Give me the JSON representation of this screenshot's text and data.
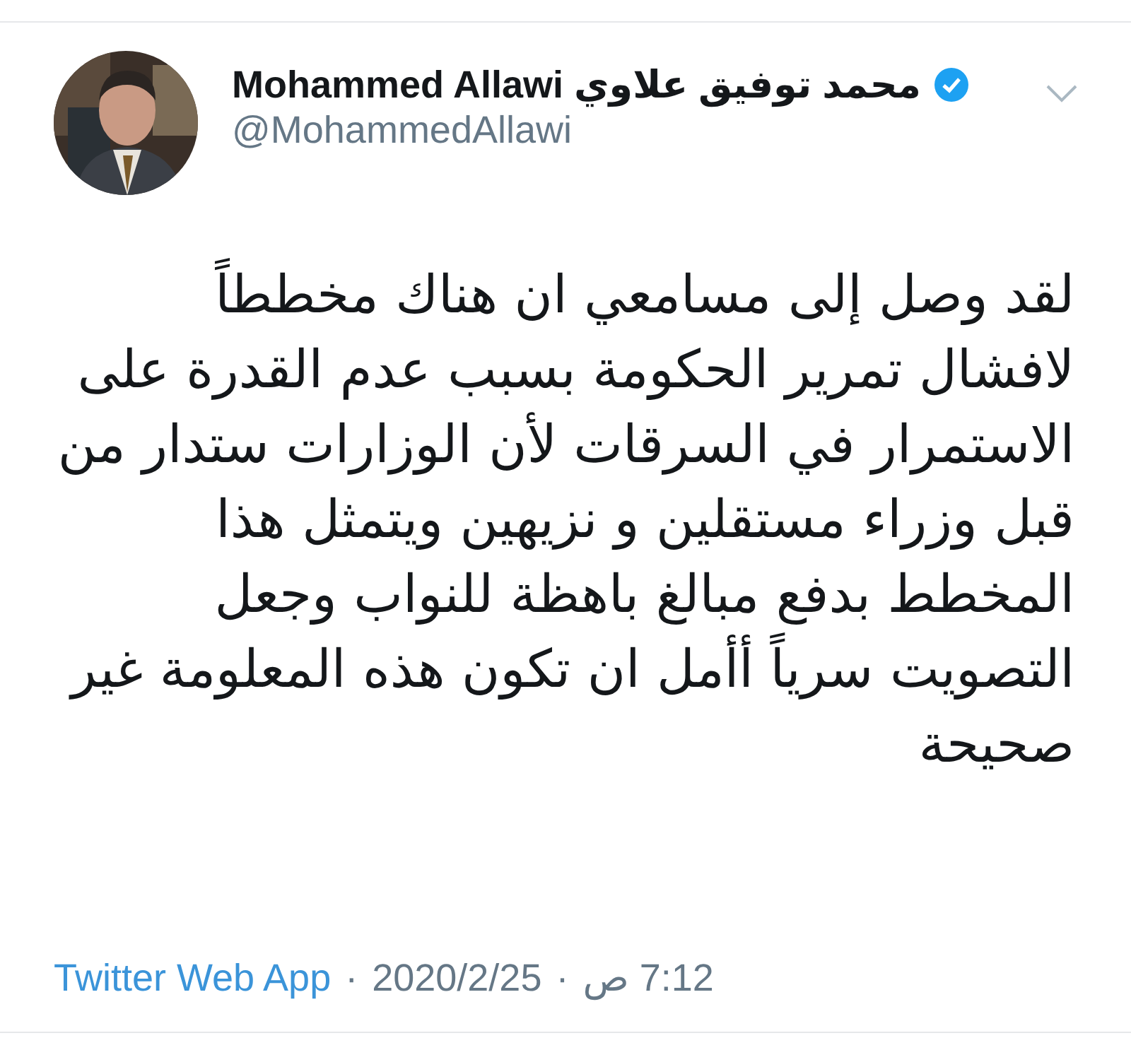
{
  "tweet": {
    "author": {
      "name": "Mohammed Allawi محمد توفيق علاوي",
      "verified": true,
      "handle": "@MohammedAllawi"
    },
    "text": "لقد وصل إلى مسامعي ان هناك مخططاً لافشال تمرير الحكومة بسبب عدم القدرة على الاستمرار في السرقات لأن الوزارات ستدار من قبل وزراء مستقلين و نزيهين ويتمثل هذا المخطط بدفع مبالغ باهظة للنواب وجعل التصويت سرياً أأمل ان تكون هذه المعلومة غير صحيحة",
    "footer": {
      "source": "Twitter Web App",
      "separator_1": "·",
      "date": "2020/2/25",
      "separator_2": "·",
      "time": "7:12 ص"
    }
  }
}
